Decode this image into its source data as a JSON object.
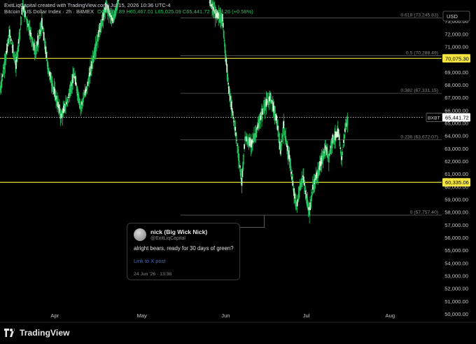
{
  "header": {
    "byline": "ExitLiqCapital created with TradingView.com, Jul 15, 2026 10:36 UTC-4",
    "symbol_prefix": "Bitcoin / US Dollar Index · 2h · BitMEX",
    "ohlc": "O65,066.89 H65,467.01 L65,025.09 C65,441.72 +378.26 (+0.58%)"
  },
  "currency_button": "USD",
  "colors": {
    "candle": "#22c55e",
    "highlight_line": "#e6e33a",
    "highlight_label_bg": "#f5e641",
    "fib_line": "#5a5a5a",
    "text": "#d1d4dc"
  },
  "chart_data": {
    "type": "candlestick",
    "title": "Bitcoin / US Dollar Index · 2h · BitMEX",
    "ylim": [
      50000,
      74000
    ],
    "y_ticks": [
      "50,000.00",
      "51,000.00",
      "52,000.00",
      "53,000.00",
      "54,000.00",
      "55,000.00",
      "56,000.00",
      "57,000.00",
      "58,000.00",
      "59,000.00",
      "60,000.00",
      "61,000.00",
      "62,000.00",
      "63,000.00",
      "64,000.00",
      "65,000.00",
      "66,000.00",
      "67,000.00",
      "68,000.00",
      "69,000.00",
      "70,000.00",
      "71,000.00",
      "72,000.00",
      "73,000.00"
    ],
    "x_ticks": [
      "Apr",
      "May",
      "Jun",
      "Jul",
      "Aug"
    ],
    "fib_levels": [
      {
        "label": "0.618 (73,245.83)",
        "value": 73245.83
      },
      {
        "label": "0.5 (70,288.49)",
        "value": 70288.49
      },
      {
        "label": "0.382 (67,331.15)",
        "value": 67331.15
      },
      {
        "label": "0.236 (63,672.07)",
        "value": 63672.07
      },
      {
        "label": "0 (57,757.40)",
        "value": 57757.4
      }
    ],
    "highlight_levels": [
      {
        "label": "70,075.30",
        "value": 70075.3
      },
      {
        "label": "60,335.06",
        "value": 60335.06
      }
    ],
    "current_price": {
      "symbol": "BXBT",
      "label": "65,441.72",
      "value": 65441.72
    },
    "price_path": [
      {
        "x": 0,
        "y": 67500
      },
      {
        "x": 3,
        "y": 72000
      },
      {
        "x": 5,
        "y": 69500
      },
      {
        "x": 7,
        "y": 74200
      },
      {
        "x": 9,
        "y": 72500
      },
      {
        "x": 11,
        "y": 70500
      },
      {
        "x": 13,
        "y": 72800
      },
      {
        "x": 15,
        "y": 69200
      },
      {
        "x": 17,
        "y": 67300
      },
      {
        "x": 19,
        "y": 65500
      },
      {
        "x": 21,
        "y": 66800
      },
      {
        "x": 23,
        "y": 68800
      },
      {
        "x": 25,
        "y": 66200
      },
      {
        "x": 27,
        "y": 67800
      },
      {
        "x": 29,
        "y": 70200
      },
      {
        "x": 31,
        "y": 72400
      },
      {
        "x": 33,
        "y": 74200
      },
      {
        "x": 35,
        "y": 73000
      },
      {
        "x": 37,
        "y": 75000
      },
      {
        "x": 65,
        "y": 74500
      },
      {
        "x": 67,
        "y": 73500
      },
      {
        "x": 69,
        "y": 73200
      },
      {
        "x": 71,
        "y": 67500
      },
      {
        "x": 73,
        "y": 64500
      },
      {
        "x": 75,
        "y": 60300
      },
      {
        "x": 76,
        "y": 63800
      },
      {
        "x": 78,
        "y": 63300
      },
      {
        "x": 80,
        "y": 64700
      },
      {
        "x": 82,
        "y": 66300
      },
      {
        "x": 84,
        "y": 67000
      },
      {
        "x": 86,
        "y": 65000
      },
      {
        "x": 87,
        "y": 62700
      },
      {
        "x": 88,
        "y": 64800
      },
      {
        "x": 89,
        "y": 63200
      },
      {
        "x": 90,
        "y": 61900
      },
      {
        "x": 91,
        "y": 59800
      },
      {
        "x": 92,
        "y": 58300
      },
      {
        "x": 93,
        "y": 59900
      },
      {
        "x": 94,
        "y": 60800
      },
      {
        "x": 95,
        "y": 59200
      },
      {
        "x": 96,
        "y": 58000
      },
      {
        "x": 97,
        "y": 59900
      },
      {
        "x": 99,
        "y": 61400
      },
      {
        "x": 101,
        "y": 63000
      },
      {
        "x": 102,
        "y": 62300
      },
      {
        "x": 103,
        "y": 63600
      },
      {
        "x": 105,
        "y": 64200
      },
      {
        "x": 106,
        "y": 62200
      },
      {
        "x": 107,
        "y": 64400
      },
      {
        "x": 108,
        "y": 65441.72
      }
    ],
    "x_tick_positions": [
      {
        "label": "Apr",
        "x": 17
      },
      {
        "label": "May",
        "x": 44
      },
      {
        "label": "Jun",
        "x": 70
      },
      {
        "label": "Jul",
        "x": 95
      },
      {
        "label": "Aug",
        "x": 121
      }
    ],
    "xlim": [
      0,
      137
    ]
  },
  "tooltip": {
    "name": "nick (Big Wick Nick)",
    "handle": "@ExitLiqCapital",
    "body": "alright bears, ready for 30 days of green?",
    "link": "Link to X post",
    "date": "24 Jun '26 · 13:38"
  },
  "footer": {
    "brand": "TradingView"
  }
}
